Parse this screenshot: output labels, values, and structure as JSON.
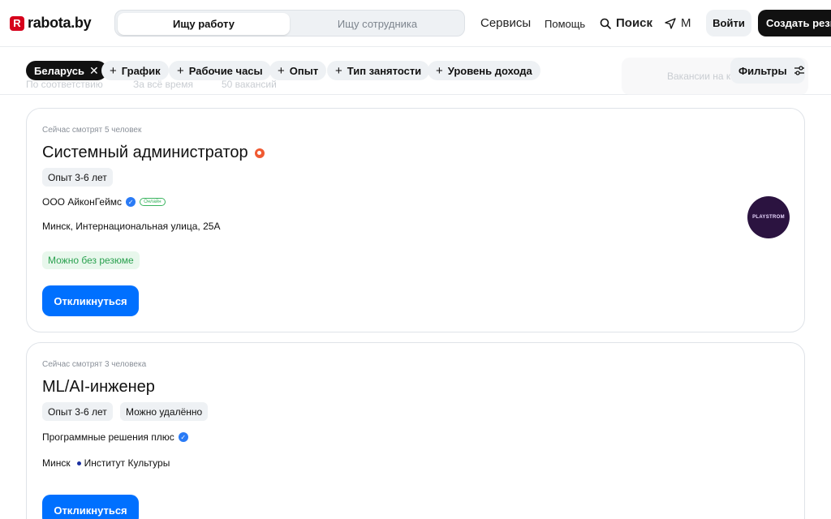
{
  "header": {
    "logo_mark": "R",
    "logo_text": "rabota.by",
    "role_switch": {
      "active": "Ищу работу",
      "inactive": "Ищу сотрудника"
    },
    "services": "Сервисы",
    "help": "Помощь",
    "search": "Поиск",
    "geo": "М",
    "login": "Войти",
    "create_resume": "Создать резюме"
  },
  "filters": {
    "active_chip": "Беларусь",
    "chips": [
      "График",
      "Рабочие часы",
      "Опыт",
      "Тип занятости",
      "Уровень дохода"
    ],
    "filters_button": "Фильтры",
    "ghost_sort": "По соответствию",
    "ghost_period": "За всё время",
    "ghost_count": "50 вакансий",
    "ghost_map": "Вакансии на карте"
  },
  "vacancies": [
    {
      "watching": "Сейчас смотрят 5 человек",
      "title": "Системный администратор",
      "tags": [
        "Опыт 3-6 лет"
      ],
      "company": "ООО АйконГеймс",
      "online_badge": "Онлайн",
      "address": "Минск, Интернациональная улица, 25А",
      "no_resume": "Можно без резюме",
      "apply": "Откликнуться",
      "logo_text": "PLAYSTROM"
    },
    {
      "watching": "Сейчас смотрят 3 человека",
      "title": "ML/AI-инженер",
      "tags": [
        "Опыт 3-6 лет",
        "Можно удалённо"
      ],
      "company": "Программные решения плюс",
      "city": "Минск",
      "metro": "Институт Культуры",
      "apply": "Откликнуться"
    }
  ],
  "colors": {
    "brand_red": "#d6001c",
    "primary_blue": "#0070ff",
    "success_green": "#2aa14f",
    "metro_blue": "#1a2fa0"
  }
}
